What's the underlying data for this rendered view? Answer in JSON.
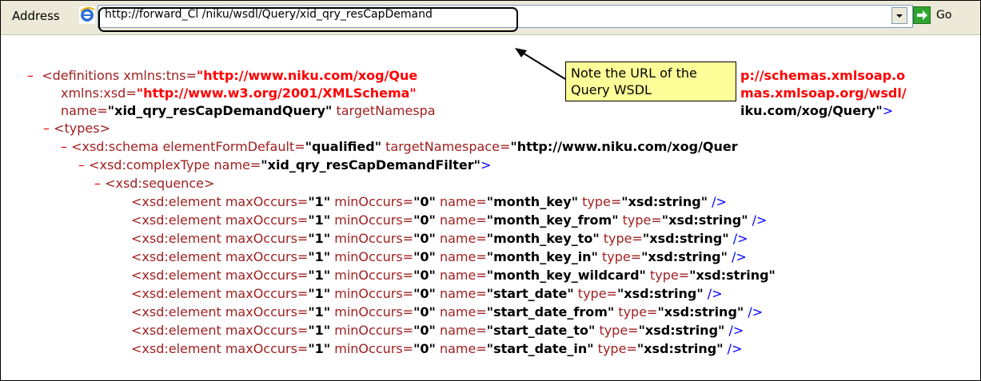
{
  "address_bar": {
    "label": "Address",
    "url": "http://forward_Cl /niku/wsdl/Query/xid_qry_resCapDemand",
    "go_label": "Go"
  },
  "callout": {
    "line1": "Note the URL of the",
    "line2": "Query WSDL"
  },
  "xml": {
    "definitions": {
      "tag": "<definitions",
      "attr1": "xmlns:tns=",
      "val1": "\"http://www.niku.com/xog/Que",
      "val2_tail": "p://schemas.xmlsoap.o",
      "attr3": "xmlns:xsd=",
      "val3": "\"http://www.w3.org/2001/XMLSchema\"",
      "val4_tail": "mas.xmlsoap.org/wsdl/",
      "attr5": "name=",
      "val5": "\"xid_qry_resCapDemandQuery\"",
      "attr6": "targetNamespa",
      "val6_tail": "iku.com/xog/Query\"",
      "end6": ">"
    },
    "types": "<types>",
    "schema": {
      "tag": "<xsd:schema",
      "attr1": "elementFormDefault=",
      "val1": "\"qualified\"",
      "attr2": "targetNamespace=",
      "val2": "\"http://www.niku.com/xog/Quer"
    },
    "complex": {
      "tag": "<xsd:complexType",
      "attr": "name=",
      "val": "\"xid_qry_resCapDemandFilter\"",
      "end": ">"
    },
    "sequence": "<xsd:sequence>",
    "elements": [
      {
        "name": "\"month_key\"",
        "type": "\"xsd:string\"",
        "end": " />"
      },
      {
        "name": "\"month_key_from\"",
        "type": "\"xsd:string\"",
        "end": " />"
      },
      {
        "name": "\"month_key_to\"",
        "type": "\"xsd:string\"",
        "end": " />"
      },
      {
        "name": "\"month_key_in\"",
        "type": "\"xsd:string\"",
        "end": " />"
      },
      {
        "name": "\"month_key_wildcard\"",
        "type": "\"xsd:string\"",
        "end": ""
      },
      {
        "name": "\"start_date\"",
        "type": "\"xsd:string\"",
        "end": " />"
      },
      {
        "name": "\"start_date_from\"",
        "type": "\"xsd:string\"",
        "end": " />"
      },
      {
        "name": "\"start_date_to\"",
        "type": "\"xsd:string\"",
        "end": " />"
      },
      {
        "name": "\"start_date_in\"",
        "type": "\"xsd:string\"",
        "end": " />"
      }
    ],
    "element_tag": "<xsd:element",
    "max_attr": "maxOccurs=",
    "max_val": "\"1\"",
    "min_attr": "minOccurs=",
    "min_val": "\"0\"",
    "name_attr": "name=",
    "type_attr": "type=",
    "collapse": "–"
  }
}
